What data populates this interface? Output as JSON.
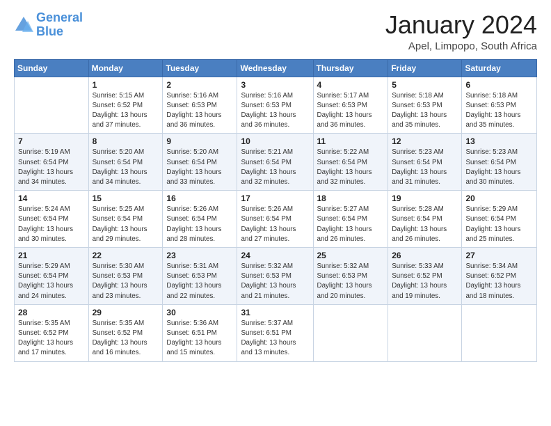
{
  "logo": {
    "text_general": "General",
    "text_blue": "Blue"
  },
  "header": {
    "month": "January 2024",
    "location": "Apel, Limpopo, South Africa"
  },
  "weekdays": [
    "Sunday",
    "Monday",
    "Tuesday",
    "Wednesday",
    "Thursday",
    "Friday",
    "Saturday"
  ],
  "weeks": [
    [
      {
        "day": "",
        "sunrise": "",
        "sunset": "",
        "daylight": ""
      },
      {
        "day": "1",
        "sunrise": "Sunrise: 5:15 AM",
        "sunset": "Sunset: 6:52 PM",
        "daylight": "Daylight: 13 hours and 37 minutes."
      },
      {
        "day": "2",
        "sunrise": "Sunrise: 5:16 AM",
        "sunset": "Sunset: 6:53 PM",
        "daylight": "Daylight: 13 hours and 36 minutes."
      },
      {
        "day": "3",
        "sunrise": "Sunrise: 5:16 AM",
        "sunset": "Sunset: 6:53 PM",
        "daylight": "Daylight: 13 hours and 36 minutes."
      },
      {
        "day": "4",
        "sunrise": "Sunrise: 5:17 AM",
        "sunset": "Sunset: 6:53 PM",
        "daylight": "Daylight: 13 hours and 36 minutes."
      },
      {
        "day": "5",
        "sunrise": "Sunrise: 5:18 AM",
        "sunset": "Sunset: 6:53 PM",
        "daylight": "Daylight: 13 hours and 35 minutes."
      },
      {
        "day": "6",
        "sunrise": "Sunrise: 5:18 AM",
        "sunset": "Sunset: 6:53 PM",
        "daylight": "Daylight: 13 hours and 35 minutes."
      }
    ],
    [
      {
        "day": "7",
        "sunrise": "Sunrise: 5:19 AM",
        "sunset": "Sunset: 6:54 PM",
        "daylight": "Daylight: 13 hours and 34 minutes."
      },
      {
        "day": "8",
        "sunrise": "Sunrise: 5:20 AM",
        "sunset": "Sunset: 6:54 PM",
        "daylight": "Daylight: 13 hours and 34 minutes."
      },
      {
        "day": "9",
        "sunrise": "Sunrise: 5:20 AM",
        "sunset": "Sunset: 6:54 PM",
        "daylight": "Daylight: 13 hours and 33 minutes."
      },
      {
        "day": "10",
        "sunrise": "Sunrise: 5:21 AM",
        "sunset": "Sunset: 6:54 PM",
        "daylight": "Daylight: 13 hours and 32 minutes."
      },
      {
        "day": "11",
        "sunrise": "Sunrise: 5:22 AM",
        "sunset": "Sunset: 6:54 PM",
        "daylight": "Daylight: 13 hours and 32 minutes."
      },
      {
        "day": "12",
        "sunrise": "Sunrise: 5:23 AM",
        "sunset": "Sunset: 6:54 PM",
        "daylight": "Daylight: 13 hours and 31 minutes."
      },
      {
        "day": "13",
        "sunrise": "Sunrise: 5:23 AM",
        "sunset": "Sunset: 6:54 PM",
        "daylight": "Daylight: 13 hours and 30 minutes."
      }
    ],
    [
      {
        "day": "14",
        "sunrise": "Sunrise: 5:24 AM",
        "sunset": "Sunset: 6:54 PM",
        "daylight": "Daylight: 13 hours and 30 minutes."
      },
      {
        "day": "15",
        "sunrise": "Sunrise: 5:25 AM",
        "sunset": "Sunset: 6:54 PM",
        "daylight": "Daylight: 13 hours and 29 minutes."
      },
      {
        "day": "16",
        "sunrise": "Sunrise: 5:26 AM",
        "sunset": "Sunset: 6:54 PM",
        "daylight": "Daylight: 13 hours and 28 minutes."
      },
      {
        "day": "17",
        "sunrise": "Sunrise: 5:26 AM",
        "sunset": "Sunset: 6:54 PM",
        "daylight": "Daylight: 13 hours and 27 minutes."
      },
      {
        "day": "18",
        "sunrise": "Sunrise: 5:27 AM",
        "sunset": "Sunset: 6:54 PM",
        "daylight": "Daylight: 13 hours and 26 minutes."
      },
      {
        "day": "19",
        "sunrise": "Sunrise: 5:28 AM",
        "sunset": "Sunset: 6:54 PM",
        "daylight": "Daylight: 13 hours and 26 minutes."
      },
      {
        "day": "20",
        "sunrise": "Sunrise: 5:29 AM",
        "sunset": "Sunset: 6:54 PM",
        "daylight": "Daylight: 13 hours and 25 minutes."
      }
    ],
    [
      {
        "day": "21",
        "sunrise": "Sunrise: 5:29 AM",
        "sunset": "Sunset: 6:54 PM",
        "daylight": "Daylight: 13 hours and 24 minutes."
      },
      {
        "day": "22",
        "sunrise": "Sunrise: 5:30 AM",
        "sunset": "Sunset: 6:53 PM",
        "daylight": "Daylight: 13 hours and 23 minutes."
      },
      {
        "day": "23",
        "sunrise": "Sunrise: 5:31 AM",
        "sunset": "Sunset: 6:53 PM",
        "daylight": "Daylight: 13 hours and 22 minutes."
      },
      {
        "day": "24",
        "sunrise": "Sunrise: 5:32 AM",
        "sunset": "Sunset: 6:53 PM",
        "daylight": "Daylight: 13 hours and 21 minutes."
      },
      {
        "day": "25",
        "sunrise": "Sunrise: 5:32 AM",
        "sunset": "Sunset: 6:53 PM",
        "daylight": "Daylight: 13 hours and 20 minutes."
      },
      {
        "day": "26",
        "sunrise": "Sunrise: 5:33 AM",
        "sunset": "Sunset: 6:52 PM",
        "daylight": "Daylight: 13 hours and 19 minutes."
      },
      {
        "day": "27",
        "sunrise": "Sunrise: 5:34 AM",
        "sunset": "Sunset: 6:52 PM",
        "daylight": "Daylight: 13 hours and 18 minutes."
      }
    ],
    [
      {
        "day": "28",
        "sunrise": "Sunrise: 5:35 AM",
        "sunset": "Sunset: 6:52 PM",
        "daylight": "Daylight: 13 hours and 17 minutes."
      },
      {
        "day": "29",
        "sunrise": "Sunrise: 5:35 AM",
        "sunset": "Sunset: 6:52 PM",
        "daylight": "Daylight: 13 hours and 16 minutes."
      },
      {
        "day": "30",
        "sunrise": "Sunrise: 5:36 AM",
        "sunset": "Sunset: 6:51 PM",
        "daylight": "Daylight: 13 hours and 15 minutes."
      },
      {
        "day": "31",
        "sunrise": "Sunrise: 5:37 AM",
        "sunset": "Sunset: 6:51 PM",
        "daylight": "Daylight: 13 hours and 13 minutes."
      },
      {
        "day": "",
        "sunrise": "",
        "sunset": "",
        "daylight": ""
      },
      {
        "day": "",
        "sunrise": "",
        "sunset": "",
        "daylight": ""
      },
      {
        "day": "",
        "sunrise": "",
        "sunset": "",
        "daylight": ""
      }
    ]
  ]
}
